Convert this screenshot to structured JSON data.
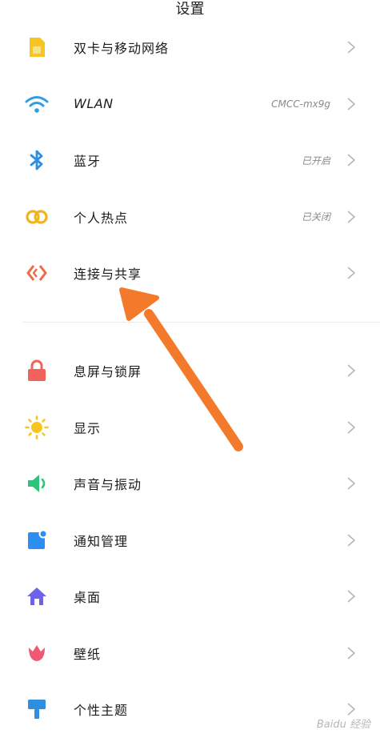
{
  "header": {
    "title": "设置"
  },
  "group_connectivity": [
    {
      "label": "双卡与移动网络",
      "value": "",
      "icon": "sim-card-icon",
      "color": "#f7c51f"
    },
    {
      "label": "WLAN",
      "value": "CMCC-mx9g",
      "icon": "wifi-icon",
      "color": "#2e9de8"
    },
    {
      "label": "蓝牙",
      "value": "已开启",
      "icon": "bluetooth-icon",
      "color": "#2e8fe0"
    },
    {
      "label": "个人热点",
      "value": "已关闭",
      "icon": "hotspot-icon",
      "color": "#f2b41c"
    },
    {
      "label": "连接与共享",
      "value": "",
      "icon": "share-icon",
      "color": "#ef6a46"
    }
  ],
  "group_device": [
    {
      "label": "息屏与锁屏",
      "icon": "lock-icon",
      "color": "#f0625a"
    },
    {
      "label": "显示",
      "icon": "sun-icon",
      "color": "#f7c51f"
    },
    {
      "label": "声音与振动",
      "icon": "speaker-icon",
      "color": "#2ec37a"
    },
    {
      "label": "通知管理",
      "icon": "notification-icon",
      "color": "#2a8ff0"
    },
    {
      "label": "桌面",
      "icon": "home-icon",
      "color": "#6d63ea"
    },
    {
      "label": "壁纸",
      "icon": "tulip-icon",
      "color": "#ee5a75"
    },
    {
      "label": "个性主题",
      "icon": "brush-icon",
      "color": "#2e8fe0"
    }
  ],
  "annotation": {
    "arrow_color": "#f47a2b"
  },
  "watermark": {
    "text": "Baidu 经验"
  }
}
